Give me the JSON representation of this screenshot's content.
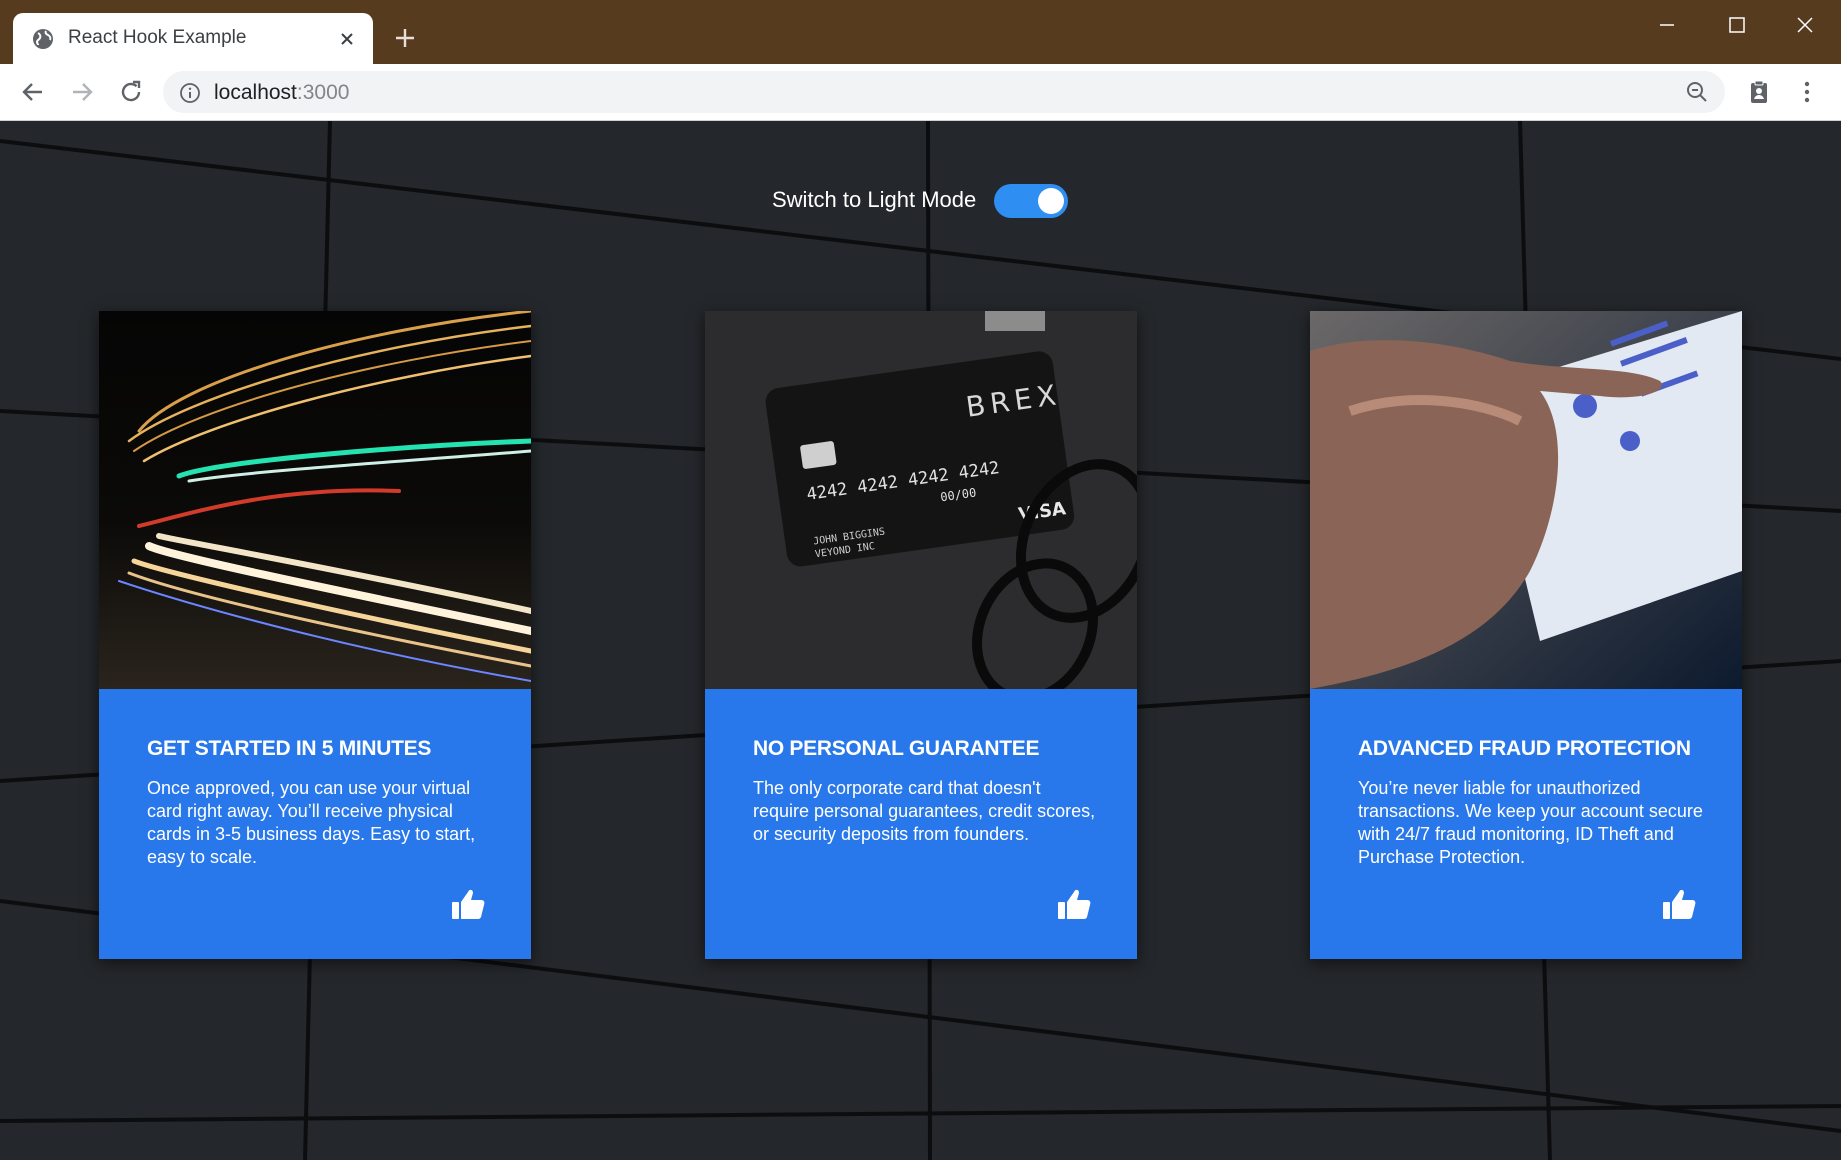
{
  "browser": {
    "tab_title": "React Hook Example",
    "url_host": "localhost",
    "url_port": ":3000"
  },
  "theme_toggle": {
    "label": "Switch to Light Mode",
    "checked": true
  },
  "cards": [
    {
      "title": "GET STARTED IN 5 MINUTES",
      "text": "Once approved, you can use your virtual card right away. You’ll receive physical cards in 3-5 business days. Easy to start, easy to scale.",
      "image": "light-trails-photo"
    },
    {
      "title": "NO PERSONAL GUARANTEE",
      "text": "The only corporate card that doesn't require personal guarantees, credit scores, or security deposits from founders.",
      "image": "brex-card-photo",
      "image_text": {
        "brand": "BREX",
        "number": "4242 4242 4242 4242",
        "expiry": "00/00",
        "holder": "JOHN BIGGINS",
        "company": "VEYOND INC",
        "network": "VISA"
      }
    },
    {
      "title": "ADVANCED FRAUD PROTECTION",
      "text": "You’re never liable for unauthorized transactions. We keep your account secure with 24/7 fraud monitoring, ID Theft and Purchase Protection.",
      "image": "tablet-hand-photo"
    }
  ],
  "colors": {
    "chrome_frame": "#563b1f",
    "page_bg": "#24272b",
    "card_bg": "#2878eb",
    "toggle_on": "#2f8ef2"
  }
}
